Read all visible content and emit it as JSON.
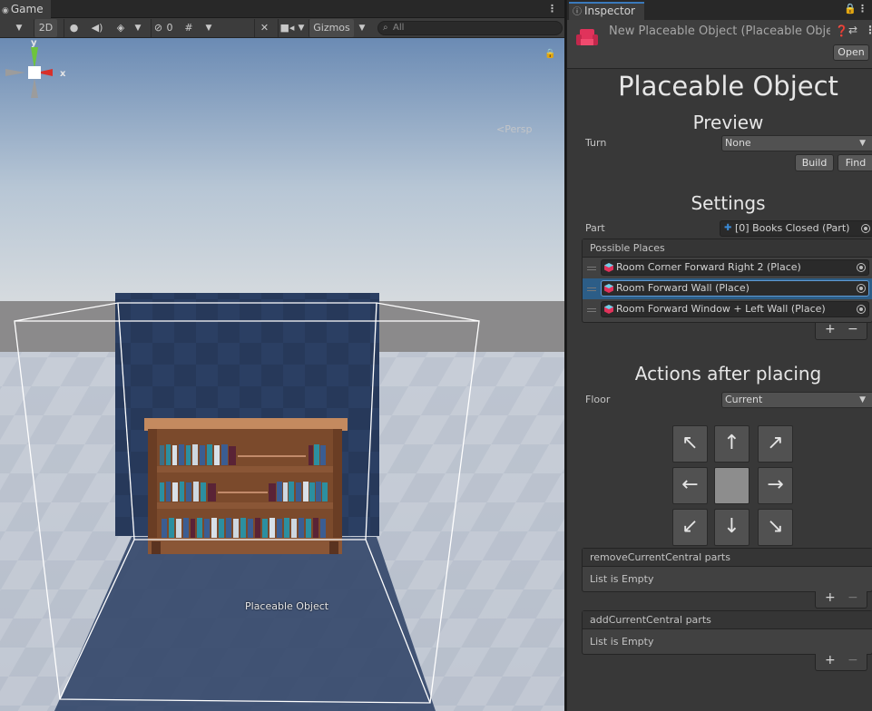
{
  "scene": {
    "tab_label": "Game",
    "toolbar": {
      "mode_2d": "2D",
      "hidden_count": "0",
      "gizmos_label": "Gizmos",
      "search_placeholder": "All"
    },
    "persp_label": "Persp",
    "axis_x": "x",
    "axis_y": "y",
    "object_label": "Placeable Object"
  },
  "inspector": {
    "tab_label": "Inspector",
    "asset_title": "New Placeable Object (Placeable Object)",
    "open_button": "Open",
    "title": "Placeable Object",
    "preview": {
      "heading": "Preview",
      "turn_label": "Turn",
      "turn_value": "None",
      "build_button": "Build",
      "find_button": "Find"
    },
    "settings": {
      "heading": "Settings",
      "part_label": "Part",
      "part_value": "[0] Books Closed (Part)",
      "places_header": "Possible Places",
      "places": [
        "Room Corner Forward Right 2 (Place)",
        "Room Forward Wall (Place)",
        "Room Forward Window + Left Wall (Place)"
      ]
    },
    "actions": {
      "heading": "Actions after placing",
      "floor_label": "Floor",
      "floor_value": "Current",
      "arrows": [
        "↖",
        "↑",
        "↗",
        "←",
        "",
        "→",
        "↙",
        "↓",
        "↘"
      ],
      "remove_list_header": "removeCurrentCentral parts",
      "remove_list_empty": "List is Empty",
      "add_list_header": "addCurrentCentral parts",
      "add_list_empty": "List is Empty"
    },
    "footer": {
      "plus": "+",
      "minus": "−"
    }
  },
  "colors": {
    "selection": "#2c5d87",
    "accent_tab": "#3a79bb",
    "asset_icon": "#e0335b"
  }
}
